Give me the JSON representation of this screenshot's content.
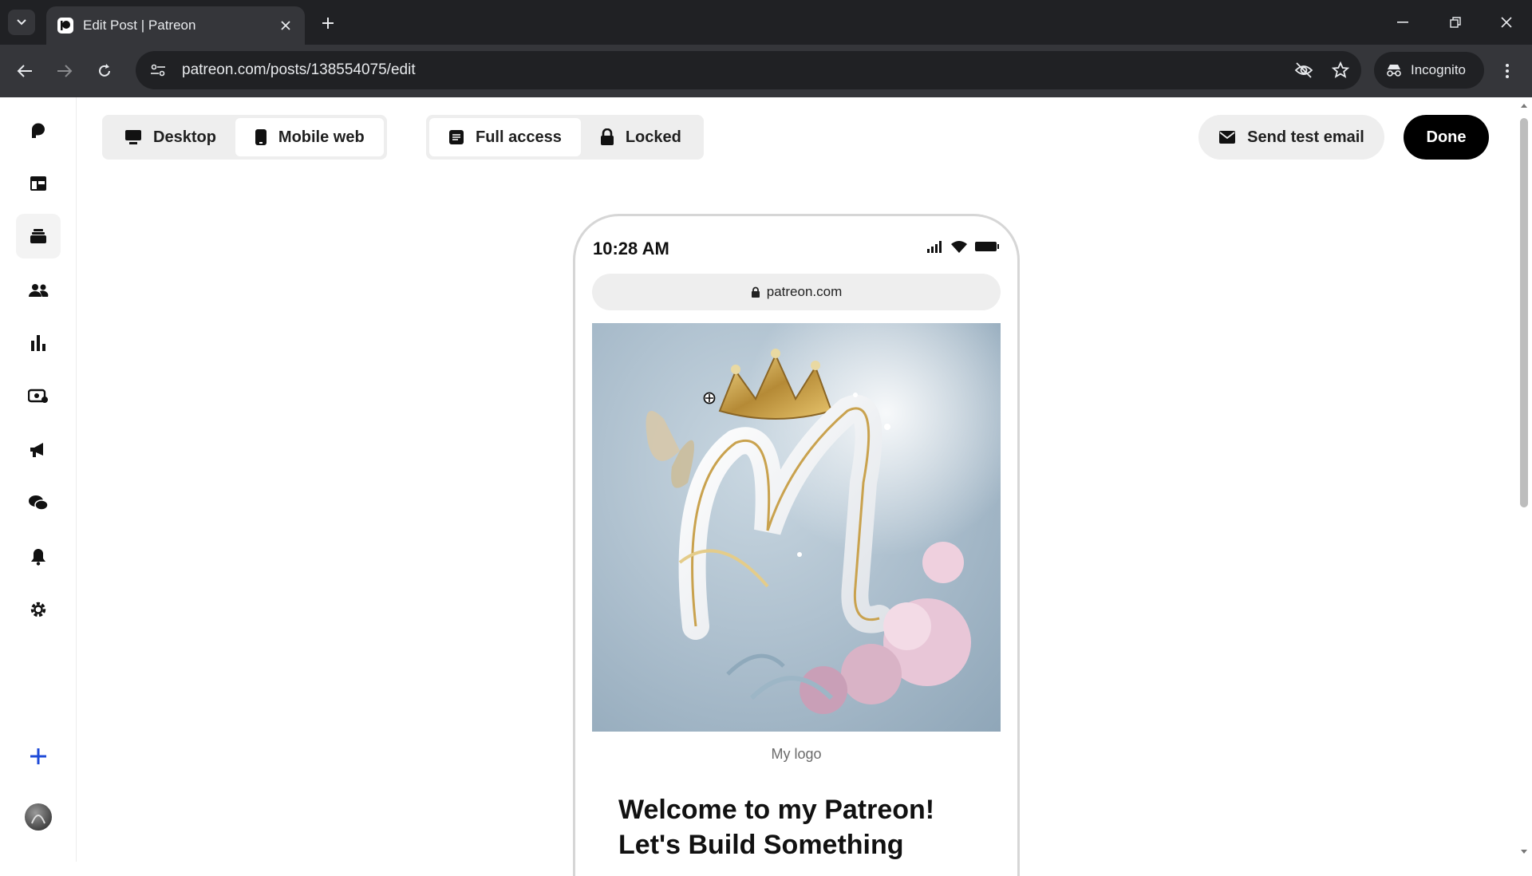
{
  "browser": {
    "tab_title": "Edit Post | Patreon",
    "url": "patreon.com/posts/138554075/edit",
    "incognito_label": "Incognito"
  },
  "sidebar": {
    "items": [
      {
        "icon": "patreon-logo-icon"
      },
      {
        "icon": "dashboard-icon"
      },
      {
        "icon": "library-icon",
        "active": true
      },
      {
        "icon": "audience-icon"
      },
      {
        "icon": "insights-icon"
      },
      {
        "icon": "payouts-icon"
      },
      {
        "icon": "promotions-icon"
      },
      {
        "icon": "chats-icon"
      },
      {
        "icon": "notifications-icon"
      },
      {
        "icon": "settings-icon"
      },
      {
        "icon": "create-plus-icon"
      },
      {
        "icon": "avatar"
      }
    ]
  },
  "header": {
    "view_toggle": {
      "desktop": "Desktop",
      "mobile": "Mobile web",
      "selected": "Mobile web"
    },
    "access_toggle": {
      "full": "Full access",
      "locked": "Locked",
      "selected": "Full access"
    },
    "send_test_email": "Send test email",
    "done": "Done"
  },
  "preview": {
    "time": "10:28 AM",
    "domain": "patreon.com",
    "image_caption": "My logo",
    "post_title_line1": "Welcome to my Patreon!",
    "post_title_line2": "Let's Build Something"
  },
  "colors": {
    "browser_dark": "#202124",
    "browser_toolbar": "#35363a",
    "segment_bg": "#eeeeee",
    "done_bg": "#000000"
  }
}
